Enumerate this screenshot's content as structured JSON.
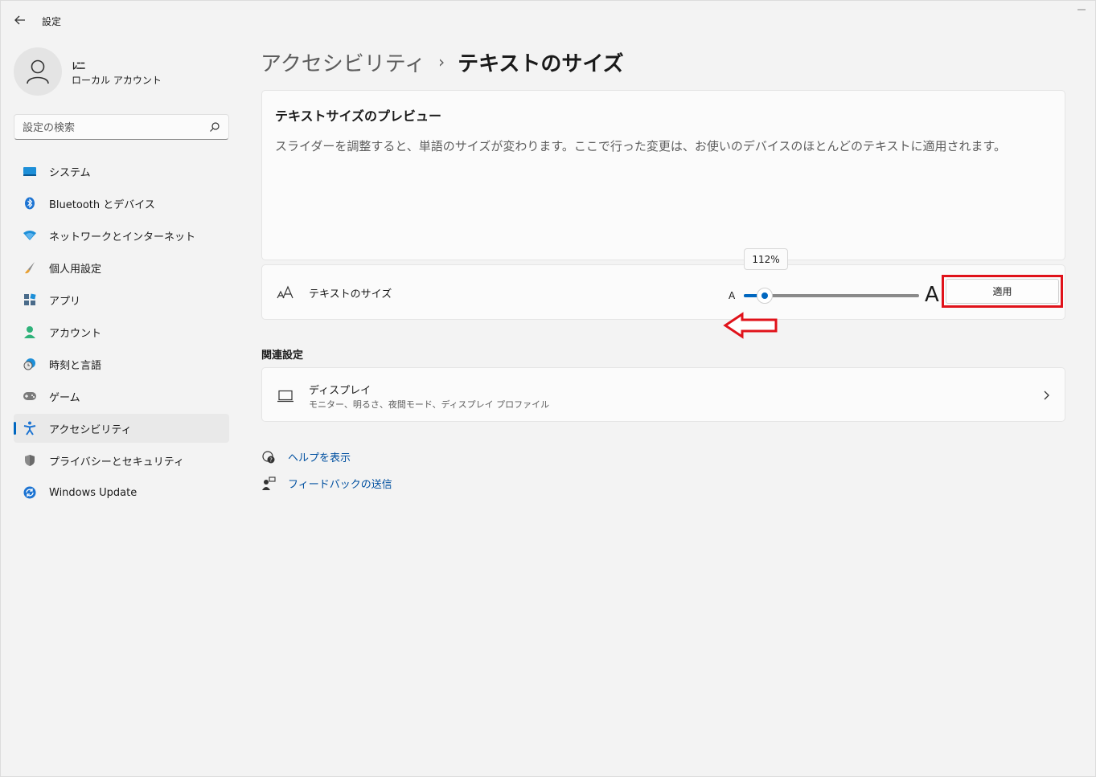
{
  "window": {
    "title": "設定"
  },
  "profile": {
    "name": "ﾚﾆﾆ",
    "account_type": "ローカル アカウント"
  },
  "search": {
    "placeholder": "設定の検索"
  },
  "sidebar": {
    "items": [
      {
        "label": "システム",
        "icon": "system-icon"
      },
      {
        "label": "Bluetooth とデバイス",
        "icon": "bluetooth-icon"
      },
      {
        "label": "ネットワークとインターネット",
        "icon": "wifi-icon"
      },
      {
        "label": "個人用設定",
        "icon": "brush-icon"
      },
      {
        "label": "アプリ",
        "icon": "apps-icon"
      },
      {
        "label": "アカウント",
        "icon": "account-icon"
      },
      {
        "label": "時刻と言語",
        "icon": "time-language-icon"
      },
      {
        "label": "ゲーム",
        "icon": "gamepad-icon"
      },
      {
        "label": "アクセシビリティ",
        "icon": "accessibility-icon",
        "active": true
      },
      {
        "label": "プライバシーとセキュリティ",
        "icon": "shield-icon"
      },
      {
        "label": "Windows Update",
        "icon": "update-icon"
      }
    ]
  },
  "main": {
    "breadcrumb": {
      "parent": "アクセシビリティ",
      "separator": "›",
      "current": "テキストのサイズ"
    },
    "preview": {
      "title": "テキストサイズのプレビュー",
      "description": "スライダーを調整すると、単語のサイズが変わります。ここで行った変更は、お使いのデバイスのほとんどのテキストに適用されます。"
    },
    "text_size": {
      "label": "テキストのサイズ",
      "small_a": "A",
      "large_a": "A",
      "value_label": "112%",
      "value_fraction": 0.12,
      "apply_label": "適用"
    },
    "related": {
      "title": "関連設定",
      "display": {
        "title": "ディスプレイ",
        "subtitle": "モニター、明るさ、夜間モード、ディスプレイ プロファイル"
      }
    },
    "links": {
      "help": "ヘルプを表示",
      "feedback": "フィードバックの送信"
    }
  },
  "colors": {
    "accent": "#0067c0",
    "highlight": "#e0121a",
    "link": "#0050a0"
  }
}
